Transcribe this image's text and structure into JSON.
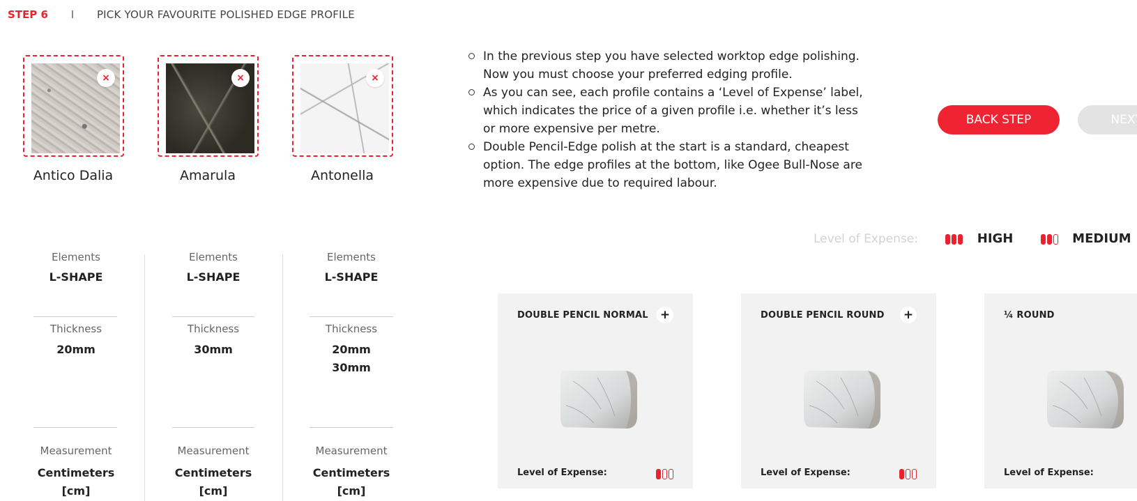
{
  "header": {
    "step_label": "STEP 6",
    "separator": "I",
    "title": "PICK YOUR FAVOURITE POLISHED EDGE PROFILE"
  },
  "materials": [
    {
      "name": "Antico Dalia",
      "remove_icon": "×",
      "swatch": "light-grey-granite"
    },
    {
      "name": "Amarula",
      "remove_icon": "×",
      "swatch": "dark-green-marble"
    },
    {
      "name": "Antonella",
      "remove_icon": "×",
      "swatch": "white-marble"
    }
  ],
  "specs": [
    {
      "elements_label": "Elements",
      "elements_value": "L-SHAPE",
      "thickness_label": "Thickness",
      "thickness_values": [
        "20mm",
        ""
      ],
      "measurement_label": "Measurement",
      "measurement_value": "Centimeters",
      "measurement_unit": "[cm]"
    },
    {
      "elements_label": "Elements",
      "elements_value": "L-SHAPE",
      "thickness_label": "Thickness",
      "thickness_values": [
        "30mm",
        ""
      ],
      "measurement_label": "Measurement",
      "measurement_value": "Centimeters",
      "measurement_unit": "[cm]"
    },
    {
      "elements_label": "Elements",
      "elements_value": "L-SHAPE",
      "thickness_label": "Thickness",
      "thickness_values": [
        "20mm",
        "30mm"
      ],
      "measurement_label": "Measurement",
      "measurement_value": "Centimeters",
      "measurement_unit": "[cm]"
    }
  ],
  "instructions": [
    "In the previous step you have selected worktop edge polishing. Now you must choose your preferred edging profile.",
    "As you can see, each profile contains a ‘Level of Expense’ label, which indicates the price of a given profile i.e. whether it’s less or more expensive per metre.",
    "Double Pencil-Edge polish at the start is a standard, cheapest option. The edge profiles at the bottom, like Ogee Bull-Nose are more expensive due to required labour."
  ],
  "buttons": {
    "back": "BACK STEP",
    "next": "NEXT"
  },
  "legend": {
    "label": "Level of Expense:",
    "items": [
      {
        "name": "HIGH",
        "level": 3
      },
      {
        "name": "MEDIUM",
        "level": 2
      }
    ]
  },
  "profiles": [
    {
      "title": "DOUBLE PENCIL NORMAL",
      "add_icon": "+",
      "expense_label": "Level of Expense:",
      "level": 1
    },
    {
      "title": "DOUBLE PENCIL ROUND",
      "add_icon": "+",
      "expense_label": "Level of Expense:",
      "level": 1
    },
    {
      "title": "¼ ROUND",
      "add_icon": "",
      "expense_label": "Level of Expense:",
      "level": null
    }
  ],
  "colors": {
    "accent": "#e8232f",
    "card_bg": "#f2f2f2",
    "disabled": "#e3e3e3"
  }
}
